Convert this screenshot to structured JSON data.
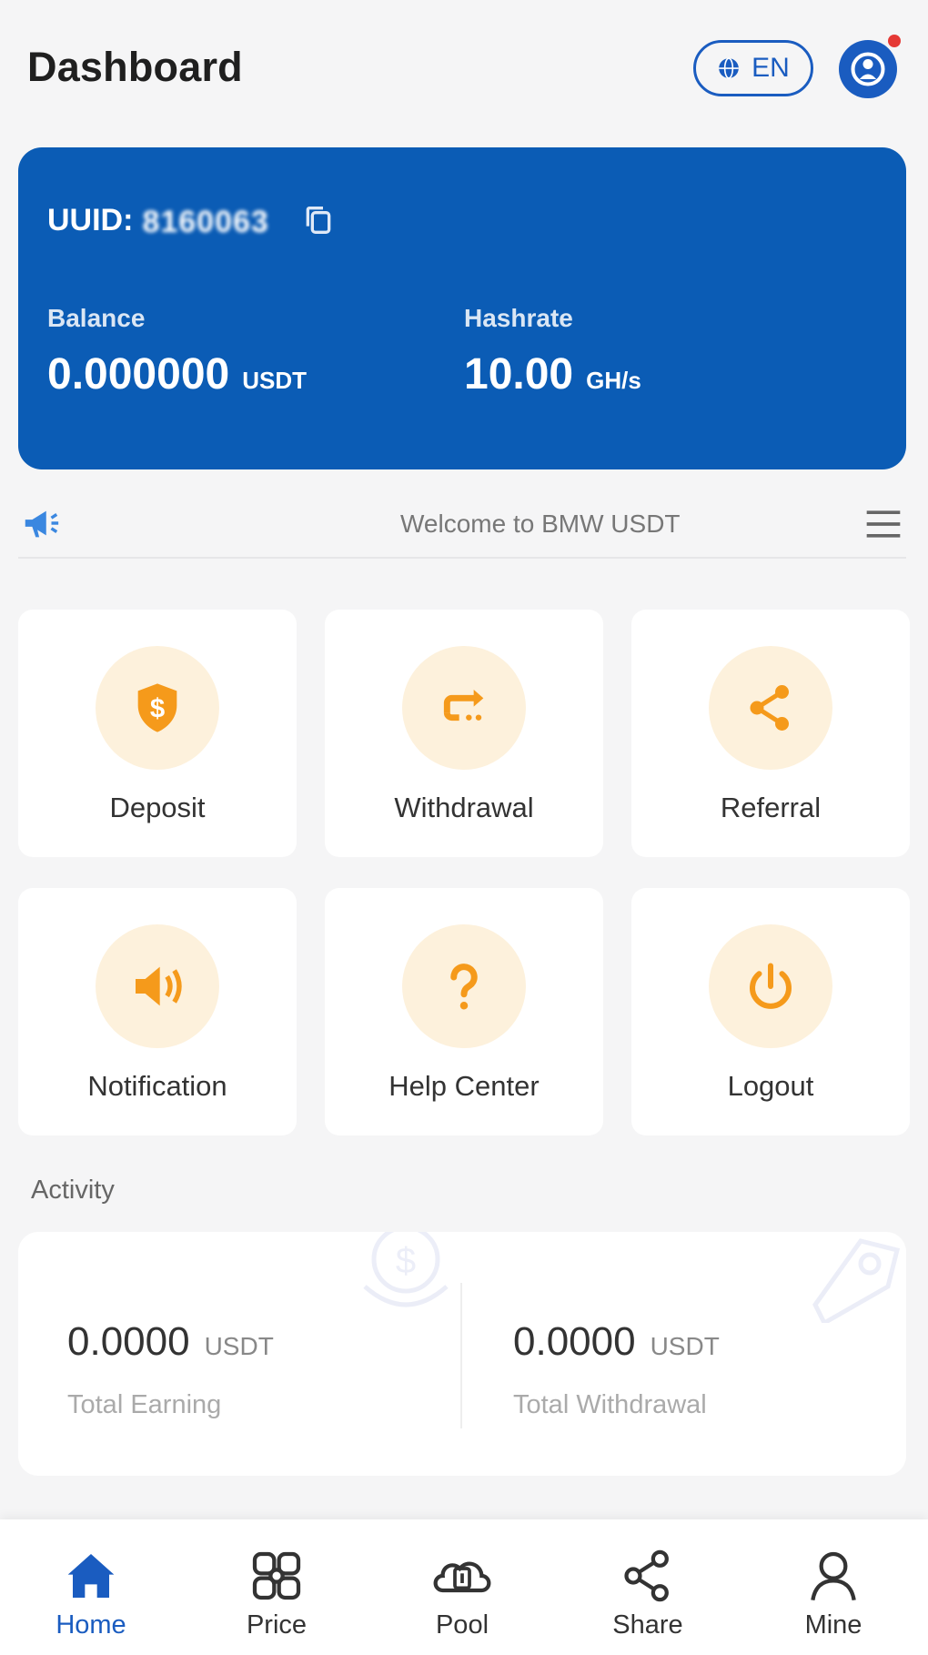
{
  "header": {
    "title": "Dashboard",
    "language_label": "EN",
    "language_icon": "globe-icon",
    "avatar_icon": "user-avatar-icon",
    "notification_dot_color": "#e53935"
  },
  "account": {
    "uid_prefix": "UUID:",
    "uid_value": "8160063",
    "copy_icon": "copy-icon",
    "balance": {
      "label": "Balance",
      "value": "0.000000",
      "unit": "USDT"
    },
    "hashrate": {
      "label": "Hashrate",
      "value": "10.00",
      "unit": "GH/s"
    },
    "card_color": "#0b5cb5"
  },
  "notice": {
    "icon": "megaphone-icon",
    "text": "Welcome to BMW USDT",
    "menu_icon": "hamburger-menu-icon"
  },
  "quick_actions": [
    {
      "label": "Deposit",
      "icon": "dollar-shield-icon"
    },
    {
      "label": "Withdrawal",
      "icon": "transfer-arrow-icon"
    },
    {
      "label": "Referral",
      "icon": "share-icon"
    },
    {
      "label": "Notification",
      "icon": "speaker-icon"
    },
    {
      "label": "Help Center",
      "icon": "question-icon"
    },
    {
      "label": "Logout",
      "icon": "power-icon"
    }
  ],
  "activity": {
    "title": "Activity",
    "total_earning": {
      "value": "0.0000",
      "unit": "USDT",
      "label": "Total Earning"
    },
    "total_withdrawal": {
      "value": "0.0000",
      "unit": "USDT",
      "label": "Total Withdrawal"
    }
  },
  "bottom_nav": [
    {
      "label": "Home",
      "icon": "home-icon",
      "active": true
    },
    {
      "label": "Price",
      "icon": "price-grid-icon",
      "active": false
    },
    {
      "label": "Pool",
      "icon": "pool-icon",
      "active": false
    },
    {
      "label": "Share",
      "icon": "share-icon",
      "active": false
    },
    {
      "label": "Mine",
      "icon": "user-icon",
      "active": false
    }
  ],
  "colors": {
    "primary": "#1a5cc0",
    "accent_orange": "#f59a1b",
    "icon_bg": "#fdf1dc",
    "page_bg": "#f5f5f6"
  }
}
